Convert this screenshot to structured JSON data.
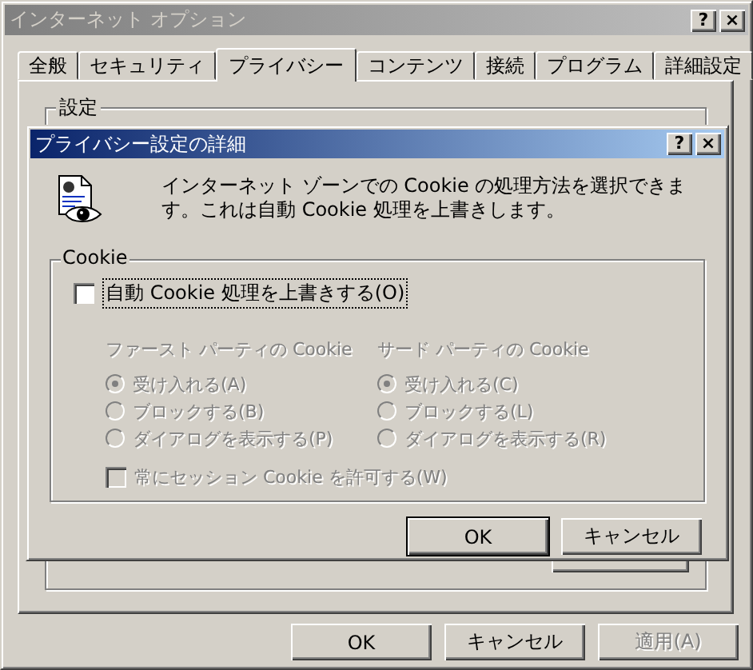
{
  "window": {
    "title": "インターネット オプション",
    "help_button": "?",
    "close_button": "×"
  },
  "tabs": [
    {
      "label": "全般",
      "selected": false
    },
    {
      "label": "セキュリティ",
      "selected": false
    },
    {
      "label": "プライバシー",
      "selected": true
    },
    {
      "label": "コンテンツ",
      "selected": false
    },
    {
      "label": "接続",
      "selected": false
    },
    {
      "label": "プログラム",
      "selected": false
    },
    {
      "label": "詳細設定",
      "selected": false
    }
  ],
  "settings_group": {
    "label": "設定"
  },
  "dialog": {
    "title": "プライバシー設定の詳細",
    "help_button": "?",
    "close_button": "×",
    "description": "インターネット ゾーンでの Cookie の処理方法を選択できます。これは自動 Cookie 処理を上書きします。",
    "group_label": "Cookie",
    "override": {
      "label": "自動 Cookie 処理を上書きする(O)",
      "checked": false,
      "focused": true
    },
    "columns": [
      {
        "heading": "ファースト パーティの Cookie",
        "options": [
          {
            "label": "受け入れる(A)",
            "selected": true,
            "disabled": true
          },
          {
            "label": "ブロックする(B)",
            "selected": false,
            "disabled": true
          },
          {
            "label": "ダイアログを表示する(P)",
            "selected": false,
            "disabled": true
          }
        ]
      },
      {
        "heading": "サード パーティの Cookie",
        "options": [
          {
            "label": "受け入れる(C)",
            "selected": true,
            "disabled": true
          },
          {
            "label": "ブロックする(L)",
            "selected": false,
            "disabled": true
          },
          {
            "label": "ダイアログを表示する(R)",
            "selected": false,
            "disabled": true
          }
        ]
      }
    ],
    "session": {
      "label": "常にセッション Cookie を許可する(W)",
      "checked": false,
      "disabled": true
    },
    "buttons": [
      {
        "label": "OK",
        "default": true
      },
      {
        "label": "キャンセル",
        "default": false
      }
    ]
  },
  "buttons": [
    {
      "label": "OK",
      "disabled": false
    },
    {
      "label": "キャンセル",
      "disabled": false
    },
    {
      "label": "適用(A)",
      "disabled": true
    }
  ]
}
